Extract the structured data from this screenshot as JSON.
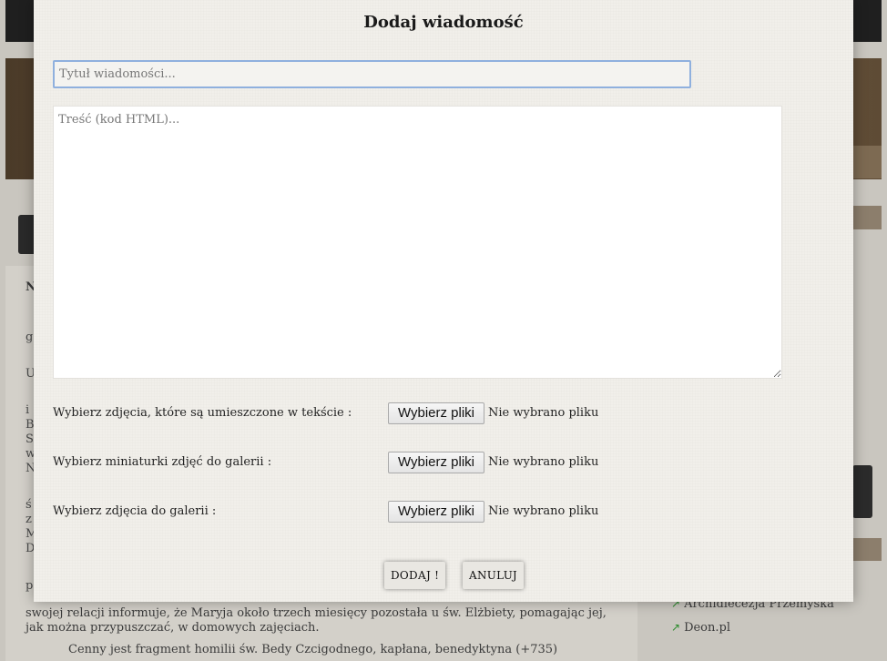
{
  "modal": {
    "title": "Dodaj wiadomość",
    "title_input": {
      "placeholder": "Tytuł wiadomości...",
      "value": ""
    },
    "body_textarea": {
      "placeholder": "Treść (kod HTML)...",
      "value": ""
    },
    "file_rows": [
      {
        "label": "Wybierz zdjęcia, które są umieszczone w tekście :",
        "button": "Wybierz pliki",
        "status": "Nie wybrano pliku"
      },
      {
        "label": "Wybierz miniaturki zdjęć do galerii :",
        "button": "Wybierz pliki",
        "status": "Nie wybrano pliku"
      },
      {
        "label": "Wybierz zdjęcia do galerii :",
        "button": "Wybierz pliki",
        "status": "Nie wybrano pliku"
      }
    ],
    "buttons": {
      "add": "DODAJ !",
      "cancel": "ANULUJ"
    }
  },
  "background": {
    "nav_text": "Na",
    "left_letters": [
      "g",
      "U",
      "i",
      "B",
      "S",
      "w",
      "N",
      "ś",
      "z",
      "M",
      "D",
      "p"
    ],
    "paragraph_lines": [
      "swojej relacji informuje, że Maryja około trzech miesięcy pozostała u św. Elżbiety, pomagając jej,",
      "jak można przypuszczać, w domowych zajęciach.",
      "Cenny jest fragment homilii św. Bedy Czcigodnego, kapłana, benedyktyna (+735)"
    ],
    "sidebar_links": [
      "Archidiecezja Przemyska",
      "Deon.pl"
    ]
  },
  "colors": {
    "modal_bg": "#f1efea",
    "input_focus_border": "#8fb0de",
    "overlay": "#c9c6bf"
  }
}
